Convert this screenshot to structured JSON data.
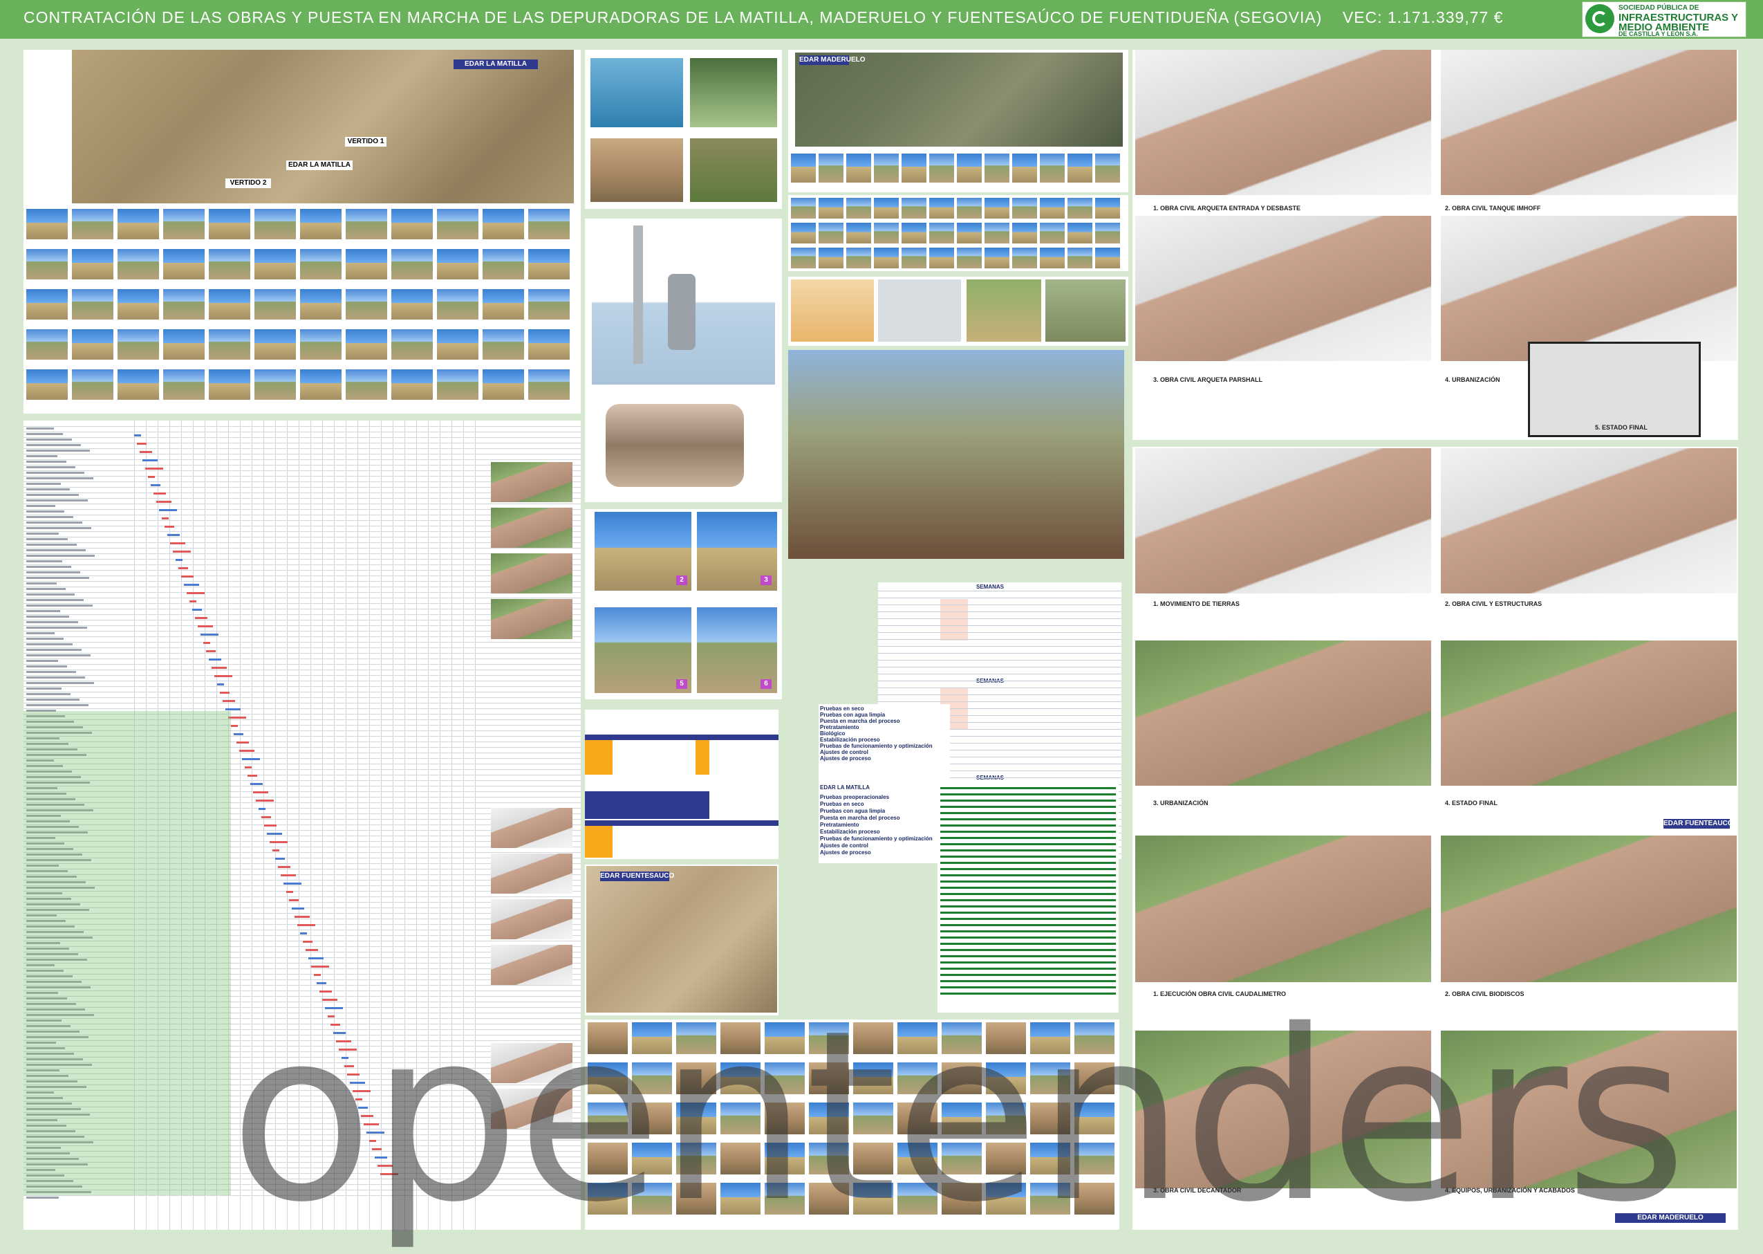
{
  "header": {
    "title": "CONTRATACIÓN DE LAS OBRAS Y PUESTA EN MARCHA DE LAS DEPURADORAS DE LA MATILLA, MADERUELO Y FUENTESAÚCO DE FUENTIDUEÑA (SEGOVIA)",
    "vec": "VEC: 1.171.339,77 €"
  },
  "logo": {
    "line1": "SOCIEDAD PÚBLICA DE",
    "line2": "INFRAESTRUCTURAS Y",
    "line3": "MEDIO AMBIENTE",
    "line4": "DE CASTILLA Y LEÓN S.A."
  },
  "left_map": {
    "edar_label": "EDAR LA MATILLA",
    "vertido1": "VERTIDO 1",
    "edar_inline": "EDAR LA MATILLA",
    "vertido2": "VERTIDO 2"
  },
  "middle_map": {
    "label": "EDAR MADERUELO"
  },
  "fuentesauco_map": {
    "label": "EDAR FUENTESAUCO"
  },
  "schedule_table": {
    "title": "SEMANAS",
    "rows": [
      "Pruebas en seco",
      "Pruebas con agua limpia",
      "Puesta en marcha del proceso",
      "Pretratamiento",
      "Biológico",
      "Estabilización proceso",
      "Pruebas de funcionamiento y optimización",
      "Ajustes de control",
      "Ajustes de proceso"
    ],
    "table2_title": "EDAR LA MATILLA",
    "table2_rows": [
      "Pruebas preoperacionales",
      "Pruebas en seco",
      "Pruebas con agua limpia",
      "Puesta en marcha del proceso",
      "Pretratamiento",
      "Estabilización proceso",
      "Pruebas de funcionamiento y optimización",
      "Ajustes de control",
      "Ajustes de proceso"
    ]
  },
  "renders_top": {
    "c1": "1. OBRA CIVIL ARQUETA ENTRADA Y DESBASTE",
    "c2": "2. OBRA CIVIL TANQUE IMHOFF",
    "c3": "3. OBRA CIVIL ARQUETA PARSHALL",
    "c4": "4. URBANIZACIÓN",
    "c5": "5. ESTADO FINAL"
  },
  "renders_mid": {
    "c1": "1. MOVIMIENTO DE TIERRAS",
    "c2": "2. OBRA CIVIL Y ESTRUCTURAS",
    "c3": "3. URBANIZACIÓN",
    "c4": "4. ESTADO FINAL",
    "label": "EDAR FUENTEAUCO"
  },
  "renders_bottom": {
    "c1": "1. EJECUCIÓN OBRA CIVIL CAUDALIMETRO",
    "c2": "2. OBRA CIVIL BIODISCOS",
    "c3": "3. OBRA CIVIL DECANTADOR",
    "c4": "4. EQUIPOS, URBANIZACIÓN Y ACABADOS",
    "label": "EDAR MADERUELO"
  },
  "photo_badges": [
    "2",
    "3",
    "5",
    "6"
  ],
  "watermark": "opentenders"
}
